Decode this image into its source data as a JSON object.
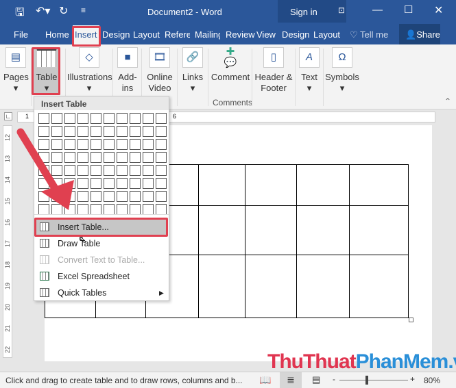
{
  "title_bar": {
    "title": "Document2  -  Word",
    "sign_in": "Sign in",
    "icons": [
      "save-icon",
      "undo-icon",
      "redo-icon",
      "customize-icon",
      "ribbon-display-icon",
      "minimize-icon",
      "maximize-icon",
      "close-icon"
    ]
  },
  "tabs": [
    "File",
    "Home",
    "Insert",
    "Design",
    "Layout",
    "Referer",
    "Mailing",
    "Review",
    "View",
    "Design",
    "Layout"
  ],
  "tell_me": "Tell me",
  "share": "Share",
  "active_tab": "Insert",
  "ribbon": {
    "groups": [
      {
        "label": "Pages"
      },
      {
        "label": "Table"
      },
      {
        "label": "Illustrations"
      },
      {
        "label": "Add-\nins"
      },
      {
        "label": "Online\nVideo"
      },
      {
        "label": "Links"
      },
      {
        "label": "Comment"
      },
      {
        "label": "Header &\nFooter"
      },
      {
        "label": "Text"
      },
      {
        "label": "Symbols"
      }
    ],
    "comments_group": "Comments"
  },
  "menu": {
    "header": "Insert Table",
    "grid": {
      "cols": 10,
      "rows": 8
    },
    "items": [
      {
        "label": "Insert Table...",
        "enabled": true,
        "highlighted": true
      },
      {
        "label": "Draw Table",
        "enabled": true
      },
      {
        "label": "Convert Text to Table...",
        "enabled": false
      },
      {
        "label": "Excel Spreadsheet",
        "enabled": true
      },
      {
        "label": "Quick Tables",
        "enabled": true,
        "submenu": true
      }
    ]
  },
  "ruler": {
    "vertical": [
      "12",
      "13",
      "14",
      "15",
      "16",
      "17",
      "18",
      "19",
      "20",
      "21",
      "22"
    ],
    "top": [
      "1",
      "6"
    ]
  },
  "status": {
    "text": "Click and drag to create table and to draw rows, columns and b...",
    "zoom": "80%"
  },
  "watermark": "ThuThuatPhanMem.vn",
  "colors": {
    "word_blue": "#2b579a",
    "highlight": "#e04050"
  }
}
